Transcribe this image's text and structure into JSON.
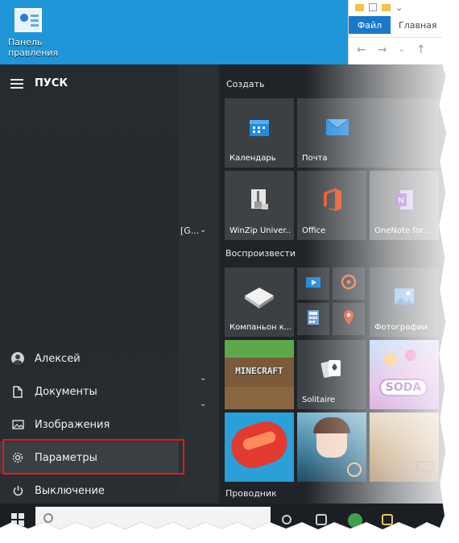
{
  "desktop": {
    "icon_label_line1": "Панель",
    "icon_label_line2": "правления"
  },
  "explorer": {
    "tab_file": "Файл",
    "tab_home": "Главная"
  },
  "start": {
    "title": "ПУСК",
    "applist_fragment": "[G..."
  },
  "rail": {
    "items": [
      {
        "label": "Алексей",
        "icon": "user-avatar-icon"
      },
      {
        "label": "Документы",
        "icon": "document-icon"
      },
      {
        "label": "Изображения",
        "icon": "pictures-icon"
      },
      {
        "label": "Параметры",
        "icon": "gear-icon"
      },
      {
        "label": "Выключение",
        "icon": "power-icon"
      }
    ]
  },
  "groups": {
    "create": "Создать",
    "play": "Воспроизвести",
    "explorer": "Проводник"
  },
  "tiles": {
    "calendar": "Календарь",
    "mail": "Почта",
    "winzip": "WinZip Univer...",
    "office": "Office",
    "onenote": "OneNote for...",
    "companion": "Компаньон к...",
    "photos": "Фотографии",
    "solitaire": "Solitaire",
    "minecraft_logo": "MINECRAFT",
    "candy_soda_logo": "SODA"
  },
  "colors": {
    "desktop_blue": "#1e96d8",
    "highlight_red": "#e01d1d",
    "explorer_file_tab": "#1979ca"
  }
}
